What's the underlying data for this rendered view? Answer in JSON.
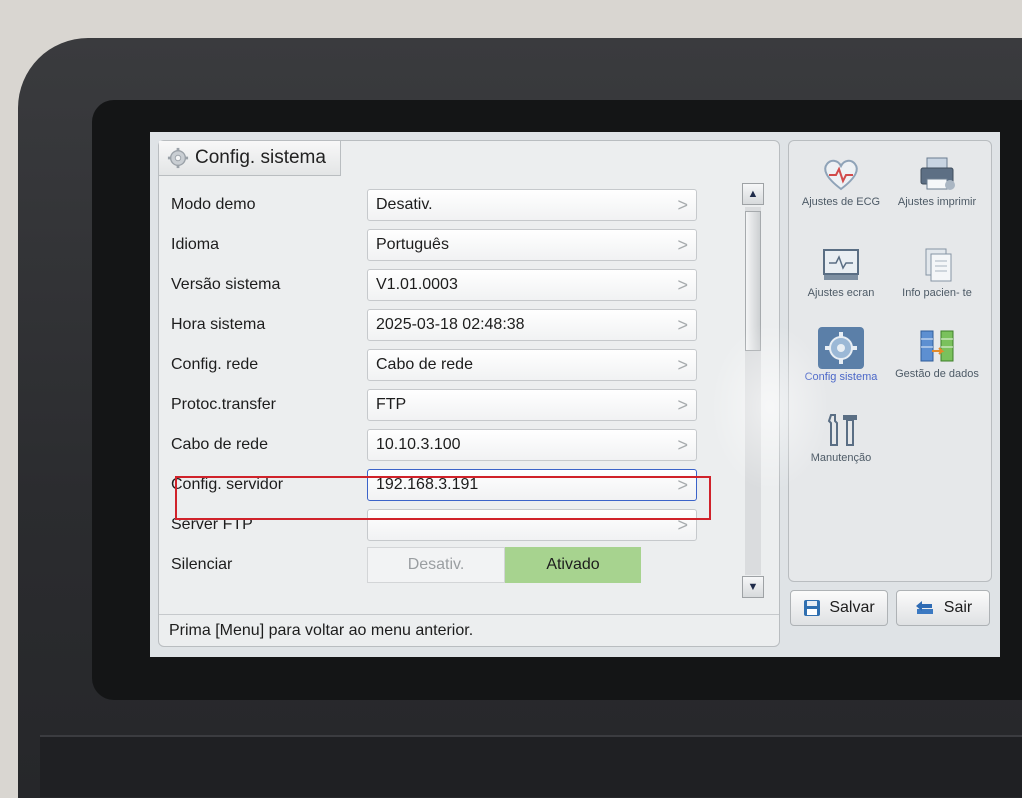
{
  "window": {
    "title": "Config. sistema"
  },
  "settings": {
    "rows": [
      {
        "label": "Modo demo",
        "value": "Desativ."
      },
      {
        "label": "Idioma",
        "value": "Português"
      },
      {
        "label": "Versão sistema",
        "value": "V1.01.0003"
      },
      {
        "label": "Hora sistema",
        "value": "2025-03-18 02:48:38"
      },
      {
        "label": "Config. rede",
        "value": "Cabo de rede"
      },
      {
        "label": "Protoc.transfer",
        "value": "FTP"
      },
      {
        "label": "Cabo de rede",
        "value": "10.10.3.100"
      },
      {
        "label": "Config. servidor",
        "value": "192.168.3.191"
      },
      {
        "label": "Server FTP",
        "value": ""
      }
    ],
    "silence": {
      "label": "Silenciar",
      "off_label": "Desativ.",
      "on_label": "Ativado",
      "selected": "Ativado"
    }
  },
  "status": {
    "message": "Prima [Menu] para voltar ao menu anterior."
  },
  "side_menu": {
    "items": [
      {
        "label": "Ajustes de ECG",
        "icon": "heart-ecg-icon"
      },
      {
        "label": "Ajustes imprimir",
        "icon": "printer-icon"
      },
      {
        "label": "Ajustes ecran",
        "icon": "monitor-icon"
      },
      {
        "label": "Info pacien- te",
        "icon": "document-icon"
      },
      {
        "label": "Config sistema",
        "icon": "gear-icon"
      },
      {
        "label": "Gestão de dados",
        "icon": "data-transfer-icon"
      },
      {
        "label": "Manutenção",
        "icon": "wrench-icon"
      }
    ],
    "active": "Config sistema"
  },
  "buttons": {
    "save_label": "Salvar",
    "exit_label": "Sair"
  },
  "colors": {
    "highlight": "#d0222a",
    "selected_border": "#3b63c9",
    "toggle_on": "#a7d38f",
    "active_menu": "#4a66c8"
  }
}
